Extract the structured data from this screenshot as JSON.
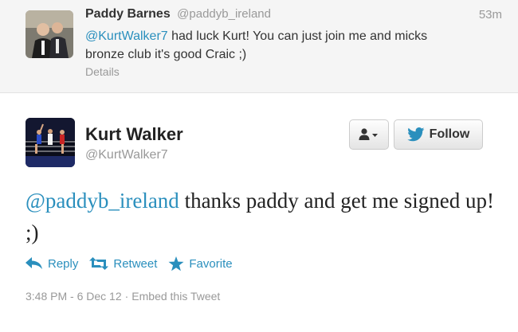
{
  "colors": {
    "link": "#2a8fbd",
    "muted": "#999999",
    "text": "#333333",
    "parent_bg": "#f5f5f5"
  },
  "parent_tweet": {
    "fullname": "Paddy Barnes",
    "username": "@paddyb_ireland",
    "time": "53m",
    "mention": "@KurtWalker7",
    "text": " had luck Kurt! You can just join me and micks bronze club it's good Craic ;)",
    "details_label": "Details",
    "avatar_icon": "profile-photo"
  },
  "tweet": {
    "fullname": "Kurt Walker",
    "username": "@KurtWalker7",
    "mention": "@paddyb_ireland",
    "text": " thanks paddy and get me signed up! ;)",
    "avatar_icon": "boxing-ring-photo",
    "follow_label": "Follow",
    "user_dropdown_icon": "user-dropdown-icon",
    "actions": {
      "reply": "Reply",
      "retweet": "Retweet",
      "favorite": "Favorite"
    },
    "timestamp": "3:48 PM - 6 Dec 12",
    "separator": "·",
    "embed_label": "Embed this Tweet"
  }
}
